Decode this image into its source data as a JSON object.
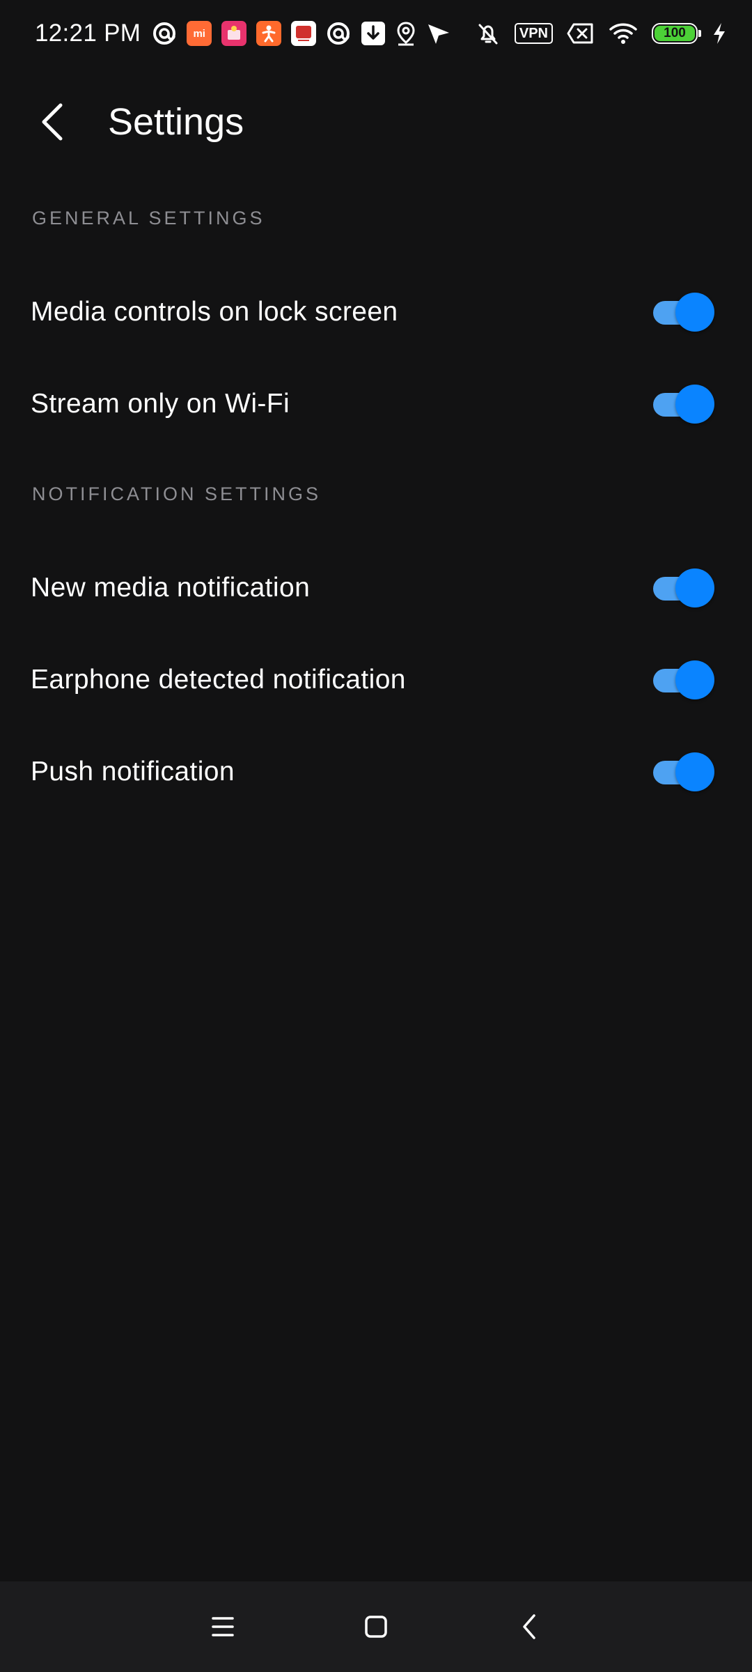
{
  "status_bar": {
    "time": "12:21 PM",
    "notification_icons": [
      "at-sign-icon",
      "mi-app-icon",
      "promo-app-icon",
      "figure-app-icon",
      "red-app-icon",
      "at-sign-icon",
      "download-icon",
      "location-pin-icon",
      "send-arrow-icon"
    ],
    "mi_label": "mi",
    "vpn_label": "VPN",
    "battery_level": "100",
    "colors": {
      "battery": "#4cd137",
      "mi_app": "#ff6b35",
      "promo_app": "#e8336d",
      "figure_app": "#ff6a2c",
      "red_app": "#d0312d"
    }
  },
  "app_bar": {
    "title": "Settings"
  },
  "sections": [
    {
      "header": "GENERAL SETTINGS",
      "items": [
        {
          "label": "Media controls on lock screen",
          "enabled": true
        },
        {
          "label": "Stream only on Wi-Fi",
          "enabled": true
        }
      ]
    },
    {
      "header": "NOTIFICATION SETTINGS",
      "items": [
        {
          "label": "New media notification",
          "enabled": true
        },
        {
          "label": "Earphone detected notification",
          "enabled": true
        },
        {
          "label": "Push notification",
          "enabled": true
        }
      ]
    }
  ],
  "nav_bar": {
    "buttons": [
      "menu-icon",
      "home-square-icon",
      "back-chevron-icon"
    ]
  },
  "colors": {
    "background": "#121213",
    "section_header": "#8e8e93",
    "toggle_track": "#4ea2f2",
    "toggle_thumb": "#0a84ff",
    "nav_background": "#1c1c1e"
  }
}
